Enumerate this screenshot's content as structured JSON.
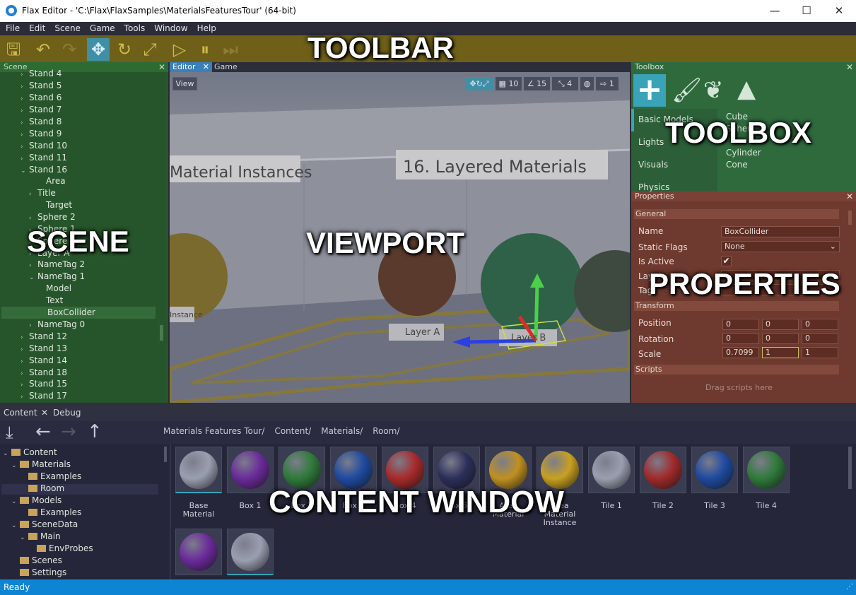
{
  "window": {
    "title": "Flax Editor - 'C:\\Flax\\FlaxSamples\\MaterialsFeaturesTour' (64-bit)",
    "minimize": "—",
    "maximize": "☐",
    "close": "✕"
  },
  "menu": [
    "File",
    "Edit",
    "Scene",
    "Game",
    "Tools",
    "Window",
    "Help"
  ],
  "toolbar": {
    "overlay_label": "TOOLBAR"
  },
  "scene": {
    "title": "Scene",
    "overlay_label": "SCENE",
    "items": [
      {
        "label": "Stand 4",
        "arrow": "›"
      },
      {
        "label": "Stand 5",
        "arrow": "›"
      },
      {
        "label": "Stand 6",
        "arrow": "›"
      },
      {
        "label": "Stand 7",
        "arrow": "›"
      },
      {
        "label": "Stand 8",
        "arrow": "›"
      },
      {
        "label": "Stand 9",
        "arrow": "›"
      },
      {
        "label": "Stand 10",
        "arrow": "›"
      },
      {
        "label": "Stand 11",
        "arrow": "›"
      },
      {
        "label": "Stand 16",
        "arrow": "⌄"
      },
      {
        "label": "Area",
        "arrow": ""
      },
      {
        "label": "Title",
        "arrow": "›"
      },
      {
        "label": "Target",
        "arrow": ""
      },
      {
        "label": "Sphere 2",
        "arrow": "›"
      },
      {
        "label": "Sphere 1",
        "arrow": "›"
      },
      {
        "label": "Sphere 0",
        "arrow": "›"
      },
      {
        "label": "Layer A",
        "arrow": "›"
      },
      {
        "label": "NameTag 2",
        "arrow": "›"
      },
      {
        "label": "NameTag 1",
        "arrow": "⌄"
      },
      {
        "label": "Model",
        "arrow": ""
      },
      {
        "label": "Text",
        "arrow": ""
      },
      {
        "label": "BoxCollider",
        "arrow": ""
      },
      {
        "label": "NameTag 0",
        "arrow": "›"
      },
      {
        "label": "Stand 12",
        "arrow": "›"
      },
      {
        "label": "Stand 13",
        "arrow": "›"
      },
      {
        "label": "Stand 14",
        "arrow": "›"
      },
      {
        "label": "Stand 18",
        "arrow": "›"
      },
      {
        "label": "Stand 15",
        "arrow": "›"
      },
      {
        "label": "Stand 17",
        "arrow": "›"
      }
    ]
  },
  "viewport": {
    "tabs": [
      "Editor",
      "Game"
    ],
    "view_button": "View",
    "overlay_label": "VIEWPORT",
    "sign_left": "Material Instances",
    "sign_right": "16. Layered Materials",
    "layer_a": "Layer A",
    "layer_b": "Layer B",
    "instance_tag": "Instance",
    "grid_snap": "10",
    "rotate_snap": "15",
    "scale_snap": "4",
    "camera_speed": "1"
  },
  "toolbox": {
    "title": "Toolbox",
    "overlay_label": "TOOLBOX",
    "categories": [
      "Basic Models",
      "Lights",
      "Visuals",
      "Physics"
    ],
    "items": [
      "Cube",
      "Sphere",
      "Cylinder",
      "Cone"
    ]
  },
  "properties": {
    "title": "Properties",
    "overlay_label": "PROPERTIES",
    "general": "General",
    "name_label": "Name",
    "name_value": "BoxCollider",
    "static_flags_label": "Static Flags",
    "static_flags_value": "None",
    "is_active_label": "Is Active",
    "layer_label": "Layer",
    "tag_label": "Tag",
    "transform": "Transform",
    "position_label": "Position",
    "position": [
      "0",
      "0",
      "0"
    ],
    "rotation_label": "Rotation",
    "rotation": [
      "0",
      "0",
      "0"
    ],
    "scale_label": "Scale",
    "scale": [
      "0.7099",
      "1",
      "1"
    ],
    "scripts": "Scripts",
    "drag_hint": "Drag scripts here"
  },
  "bottom_tabs": [
    "Content",
    "Debug"
  ],
  "content": {
    "overlay_label": "CONTENT WINDOW",
    "breadcrumb": [
      "Materials Features Tour/",
      "Content/",
      "Materials/",
      "Room/"
    ],
    "tree": [
      {
        "label": "Content",
        "level": 0,
        "arrow": "⌄"
      },
      {
        "label": "Materials",
        "level": 1,
        "arrow": "⌄"
      },
      {
        "label": "Examples",
        "level": 2,
        "arrow": ""
      },
      {
        "label": "Room",
        "level": 2,
        "arrow": ""
      },
      {
        "label": "Models",
        "level": 1,
        "arrow": "⌄"
      },
      {
        "label": "Examples",
        "level": 2,
        "arrow": ""
      },
      {
        "label": "SceneData",
        "level": 1,
        "arrow": "⌄"
      },
      {
        "label": "Main",
        "level": 2,
        "arrow": "⌄"
      },
      {
        "label": "EnvProbes",
        "level": 3,
        "arrow": ""
      },
      {
        "label": "Scenes",
        "level": 1,
        "arrow": ""
      },
      {
        "label": "Settings",
        "level": 1,
        "arrow": ""
      }
    ],
    "assets": [
      {
        "label": "Base\nMaterial",
        "color": "#9a9fb0"
      },
      {
        "label": "Box 1",
        "color": "#6a2a9a"
      },
      {
        "label": "Box 2",
        "color": "#2f7a3a"
      },
      {
        "label": "Box 3",
        "color": "#1e4aa0"
      },
      {
        "label": "Box 4",
        "color": "#a82a2a"
      },
      {
        "label": "Box 5",
        "color": "#2c2f5a"
      },
      {
        "label": "Area\nMaterial",
        "color": "#c09020"
      },
      {
        "label": "Area\nMaterial\nInstance",
        "color": "#c8a020"
      },
      {
        "label": "Tile 1",
        "color": "#9a9fb0"
      },
      {
        "label": "Tile 2",
        "color": "#a02a2a"
      },
      {
        "label": "Tile 3",
        "color": "#1e4aa0"
      },
      {
        "label": "Tile 4",
        "color": "#2f7a3a"
      },
      {
        "label": "",
        "color": "#6a2a9a"
      },
      {
        "label": "",
        "color": "#9a9fb0"
      }
    ]
  },
  "status": "Ready"
}
